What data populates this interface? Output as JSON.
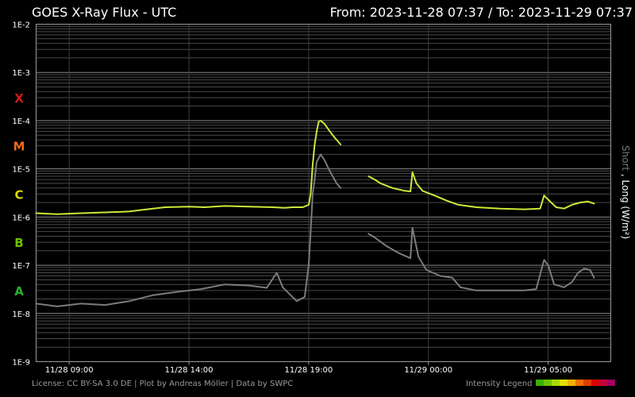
{
  "header": {
    "title": "GOES X-Ray Flux - UTC",
    "range": "From: 2023-11-28 07:37  /  To: 2023-11-29 07:37"
  },
  "footer": {
    "credits": "License: CC BY-SA 3.0 DE | Plot by Andreas Möller | Data by SWPC",
    "legend_label": "Intensity Legend",
    "legend_colors": [
      "#3cb000",
      "#6cc400",
      "#a8d800",
      "#e4e000",
      "#f0b000",
      "#f07000",
      "#e03c00",
      "#d80000",
      "#c00040",
      "#a00060"
    ]
  },
  "chart_data": {
    "type": "line",
    "title": "GOES X-Ray Flux - UTC",
    "ylabel": {
      "short": "Short",
      "sep": " , ",
      "long": "Long (W/m²)"
    },
    "y_scale": "log",
    "ylim": [
      1e-09,
      0.01
    ],
    "y_ticks": [
      {
        "value": 0.01,
        "label": "1E-2"
      },
      {
        "value": 0.001,
        "label": "1E-3"
      },
      {
        "value": 0.0001,
        "label": "1E-4"
      },
      {
        "value": 1e-05,
        "label": "1E-5"
      },
      {
        "value": 1e-06,
        "label": "1E-6"
      },
      {
        "value": 1e-07,
        "label": "1E-7"
      },
      {
        "value": 1e-08,
        "label": "1E-8"
      },
      {
        "value": 1e-09,
        "label": "1E-9"
      }
    ],
    "flare_classes": [
      {
        "label": "X",
        "value": 0.0003,
        "color": "#d41a1a"
      },
      {
        "label": "M",
        "value": 3e-05,
        "color": "#f06a1a"
      },
      {
        "label": "C",
        "value": 3e-06,
        "color": "#d8d800"
      },
      {
        "label": "B",
        "value": 3e-07,
        "color": "#6cc000"
      },
      {
        "label": "A",
        "value": 3e-08,
        "color": "#28b028"
      }
    ],
    "xlim": [
      "2023-11-28 07:37",
      "2023-11-29 07:37"
    ],
    "x_ticks": [
      {
        "value": "2023-11-28 09:00",
        "label": "11/28 09:00"
      },
      {
        "value": "2023-11-28 14:00",
        "label": "11/28 14:00"
      },
      {
        "value": "2023-11-28 19:00",
        "label": "11/28 19:00"
      },
      {
        "value": "2023-11-29 00:00",
        "label": "11/29 00:00"
      },
      {
        "value": "2023-11-29 05:00",
        "label": "11/29 05:00"
      }
    ],
    "grid": true,
    "series": [
      {
        "name": "Long",
        "color": "#cde83a",
        "segments": [
          [
            [
              "2023-11-28 07:37",
              1.2e-06
            ],
            [
              "2023-11-28 08:30",
              1.15e-06
            ],
            [
              "2023-11-28 09:30",
              1.2e-06
            ],
            [
              "2023-11-28 10:30",
              1.25e-06
            ],
            [
              "2023-11-28 11:30",
              1.3e-06
            ],
            [
              "2023-11-28 12:00",
              1.4e-06
            ],
            [
              "2023-11-28 13:00",
              1.6e-06
            ],
            [
              "2023-11-28 14:00",
              1.65e-06
            ],
            [
              "2023-11-28 14:40",
              1.6e-06
            ],
            [
              "2023-11-28 15:30",
              1.7e-06
            ],
            [
              "2023-11-28 16:30",
              1.65e-06
            ],
            [
              "2023-11-28 17:30",
              1.6e-06
            ],
            [
              "2023-11-28 18:00",
              1.55e-06
            ],
            [
              "2023-11-28 18:20",
              1.6e-06
            ],
            [
              "2023-11-28 18:45",
              1.6e-06
            ],
            [
              "2023-11-28 19:00",
              1.8e-06
            ],
            [
              "2023-11-28 19:05",
              3e-06
            ],
            [
              "2023-11-28 19:10",
              1.2e-05
            ],
            [
              "2023-11-28 19:15",
              3.2e-05
            ],
            [
              "2023-11-28 19:20",
              6e-05
            ],
            [
              "2023-11-28 19:25",
              9.5e-05
            ],
            [
              "2023-11-28 19:30",
              0.0001
            ],
            [
              "2023-11-28 19:40",
              8.5e-05
            ],
            [
              "2023-11-28 19:50",
              6.5e-05
            ],
            [
              "2023-11-28 20:00",
              5e-05
            ],
            [
              "2023-11-28 20:10",
              4e-05
            ],
            [
              "2023-11-28 20:20",
              3.2e-05
            ]
          ],
          [
            [
              "2023-11-28 21:30",
              7e-06
            ],
            [
              "2023-11-28 21:45",
              6e-06
            ],
            [
              "2023-11-28 22:00",
              5e-06
            ],
            [
              "2023-11-28 22:30",
              4e-06
            ],
            [
              "2023-11-28 23:00",
              3.5e-06
            ],
            [
              "2023-11-28 23:15",
              3.4e-06
            ],
            [
              "2023-11-28 23:20",
              8.5e-06
            ],
            [
              "2023-11-28 23:30",
              5e-06
            ],
            [
              "2023-11-28 23:45",
              3.5e-06
            ],
            [
              "2023-11-29 00:15",
              2.8e-06
            ],
            [
              "2023-11-29 00:45",
              2.2e-06
            ],
            [
              "2023-11-29 01:15",
              1.8e-06
            ],
            [
              "2023-11-29 02:00",
              1.6e-06
            ],
            [
              "2023-11-29 03:00",
              1.5e-06
            ],
            [
              "2023-11-29 04:00",
              1.45e-06
            ],
            [
              "2023-11-29 04:40",
              1.5e-06
            ],
            [
              "2023-11-29 04:50",
              2.8e-06
            ],
            [
              "2023-11-29 05:00",
              2.3e-06
            ],
            [
              "2023-11-29 05:20",
              1.6e-06
            ],
            [
              "2023-11-29 05:40",
              1.5e-06
            ],
            [
              "2023-11-29 06:00",
              1.8e-06
            ],
            [
              "2023-11-29 06:20",
              2e-06
            ],
            [
              "2023-11-29 06:40",
              2.1e-06
            ],
            [
              "2023-11-29 06:55",
              1.9e-06
            ]
          ]
        ]
      },
      {
        "name": "Short",
        "color": "#7c7c7c",
        "segments": [
          [
            [
              "2023-11-28 07:37",
              1.6e-08
            ],
            [
              "2023-11-28 08:30",
              1.4e-08
            ],
            [
              "2023-11-28 09:30",
              1.6e-08
            ],
            [
              "2023-11-28 10:30",
              1.5e-08
            ],
            [
              "2023-11-28 11:30",
              1.8e-08
            ],
            [
              "2023-11-28 12:30",
              2.4e-08
            ],
            [
              "2023-11-28 13:30",
              2.8e-08
            ],
            [
              "2023-11-28 14:30",
              3.2e-08
            ],
            [
              "2023-11-28 15:30",
              4e-08
            ],
            [
              "2023-11-28 16:30",
              3.8e-08
            ],
            [
              "2023-11-28 17:15",
              3.4e-08
            ],
            [
              "2023-11-28 17:40",
              7e-08
            ],
            [
              "2023-11-28 17:55",
              3.5e-08
            ],
            [
              "2023-11-28 18:30",
              1.8e-08
            ],
            [
              "2023-11-28 18:50",
              2.2e-08
            ],
            [
              "2023-11-28 19:00",
              1e-07
            ],
            [
              "2023-11-28 19:05",
              5e-07
            ],
            [
              "2023-11-28 19:10",
              3e-06
            ],
            [
              "2023-11-28 19:15",
              6e-06
            ],
            [
              "2023-11-28 19:20",
              1.4e-05
            ],
            [
              "2023-11-28 19:30",
              2e-05
            ],
            [
              "2023-11-28 19:40",
              1.5e-05
            ],
            [
              "2023-11-28 19:50",
              1e-05
            ],
            [
              "2023-11-28 20:00",
              7e-06
            ],
            [
              "2023-11-28 20:10",
              5e-06
            ],
            [
              "2023-11-28 20:20",
              4e-06
            ]
          ],
          [
            [
              "2023-11-28 21:30",
              4.5e-07
            ],
            [
              "2023-11-28 21:45",
              3.8e-07
            ],
            [
              "2023-11-28 22:15",
              2.5e-07
            ],
            [
              "2023-11-28 22:45",
              1.8e-07
            ],
            [
              "2023-11-28 23:15",
              1.4e-07
            ],
            [
              "2023-11-28 23:20",
              6e-07
            ],
            [
              "2023-11-28 23:35",
              1.5e-07
            ],
            [
              "2023-11-28 23:55",
              8e-08
            ],
            [
              "2023-11-29 00:30",
              6e-08
            ],
            [
              "2023-11-29 01:00",
              5.5e-08
            ],
            [
              "2023-11-29 01:20",
              3.5e-08
            ],
            [
              "2023-11-29 02:00",
              3e-08
            ],
            [
              "2023-11-29 03:00",
              3e-08
            ],
            [
              "2023-11-29 04:00",
              3e-08
            ],
            [
              "2023-11-29 04:30",
              3.2e-08
            ],
            [
              "2023-11-29 04:50",
              1.3e-07
            ],
            [
              "2023-11-29 05:00",
              1e-07
            ],
            [
              "2023-11-29 05:15",
              4e-08
            ],
            [
              "2023-11-29 05:40",
              3.5e-08
            ],
            [
              "2023-11-29 06:00",
              4.5e-08
            ],
            [
              "2023-11-29 06:15",
              7e-08
            ],
            [
              "2023-11-29 06:30",
              8.5e-08
            ],
            [
              "2023-11-29 06:45",
              8e-08
            ],
            [
              "2023-11-29 06:55",
              5.5e-08
            ]
          ]
        ]
      }
    ]
  }
}
